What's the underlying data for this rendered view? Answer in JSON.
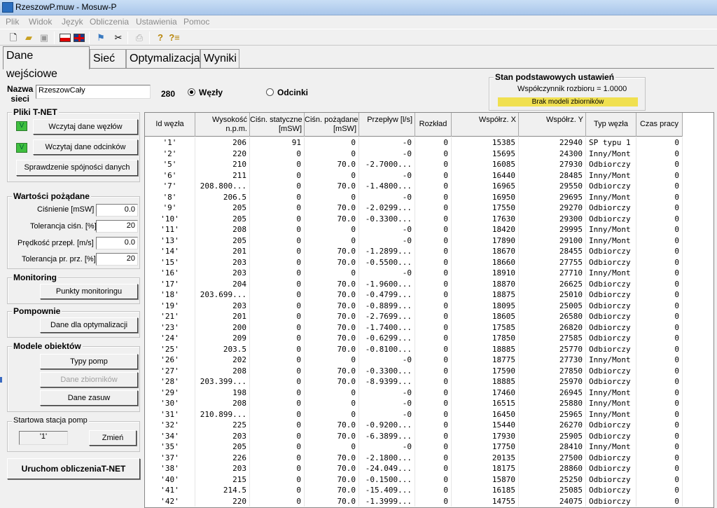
{
  "window": {
    "title": "RzeszowP.muw - Mosuw-P"
  },
  "menu": [
    "Plik",
    "Widok",
    "Język",
    "Obliczenia",
    "Ustawienia",
    "Pomoc"
  ],
  "toolbar": [
    "new-file-icon",
    "open-folder-icon",
    "save-icon",
    "polish-flag-icon",
    "uk-flag-icon",
    "hydrant-run-icon",
    "scissors-icon",
    "print-icon",
    "help-icon",
    "help-context-icon"
  ],
  "tabs": [
    "Dane wejściowe",
    "Sieć",
    "Optymalizacja",
    "Wyniki"
  ],
  "network": {
    "name_label": "Nazwa\nsieci",
    "name_value": "RzeszowCały",
    "count": "280",
    "opt_nodes": "Węzły",
    "opt_segments": "Odcinki"
  },
  "settings": {
    "title": "Stan podstawowych ustawień",
    "coef": "Współczynnik rozbioru = 1.0000",
    "tanks": "Brak modeli zbiorników"
  },
  "tnet": {
    "title": "Pliki T-NET",
    "v1": "V",
    "load_nodes": "Wczytaj dane węzłów",
    "v2": "V",
    "load_segments": "Wczytaj dane odcinków",
    "check": "Sprawdzenie spójności danych"
  },
  "desired": {
    "title": "Wartości pożądane",
    "pressure_label": "Ciśnienie [mSW]",
    "pressure": "0.0",
    "tol_p_label": "Tolerancja ciśn. [%]",
    "tol_p": "20",
    "velocity_label": "Prędkość przepł. [m/s]",
    "velocity": "0.0",
    "tol_v_label": "Tolerancja pr. prz. [%]",
    "tol_v": "20"
  },
  "monitoring": {
    "title": "Monitoring",
    "button": "Punkty monitoringu"
  },
  "pumping": {
    "title": "Pompownie",
    "button": "Dane dla optymalizacji"
  },
  "models": {
    "title": "Modele obiektów",
    "pumps": "Typy pomp",
    "tanks": "Dane zbiorników",
    "valves": "Dane zasuw"
  },
  "startpump": {
    "title": "Startowa stacja pomp",
    "value": "'1'",
    "change": "Zmień"
  },
  "run": "Uruchom obliczeniaT-NET",
  "table": {
    "headers": [
      "Id węzła",
      "Wysokość\nn.p.m.",
      "Ciśn. statyczne\n[mSW]",
      "Ciśn. pożądane\n[mSW]",
      "Przepływ [l/s]",
      "Rozkład",
      "Współrz. X",
      "Współrz. Y",
      "Typ węzła",
      "Czas pracy"
    ],
    "rows": [
      [
        "'1'",
        "206",
        "91",
        "0",
        "-0",
        "0",
        "15385",
        "22940",
        "SP typu 1",
        "0"
      ],
      [
        "'2'",
        "220",
        "0",
        "0",
        "-0",
        "0",
        "15695",
        "24300",
        "Inny/Mont",
        "0"
      ],
      [
        "'5'",
        "210",
        "0",
        "70.0",
        "-2.7000...",
        "0",
        "16085",
        "27930",
        "Odbiorczy",
        "0"
      ],
      [
        "'6'",
        "211",
        "0",
        "0",
        "-0",
        "0",
        "16440",
        "28485",
        "Inny/Mont",
        "0"
      ],
      [
        "'7'",
        "208.800...",
        "0",
        "70.0",
        "-1.4800...",
        "0",
        "16965",
        "29550",
        "Odbiorczy",
        "0"
      ],
      [
        "'8'",
        "206.5",
        "0",
        "0",
        "-0",
        "0",
        "16950",
        "29695",
        "Inny/Mont",
        "0"
      ],
      [
        "'9'",
        "205",
        "0",
        "70.0",
        "-2.0299...",
        "0",
        "17550",
        "29270",
        "Odbiorczy",
        "0"
      ],
      [
        "'10'",
        "205",
        "0",
        "70.0",
        "-0.3300...",
        "0",
        "17630",
        "29300",
        "Odbiorczy",
        "0"
      ],
      [
        "'11'",
        "208",
        "0",
        "0",
        "-0",
        "0",
        "18420",
        "29995",
        "Inny/Mont",
        "0"
      ],
      [
        "'13'",
        "205",
        "0",
        "0",
        "-0",
        "0",
        "17890",
        "29100",
        "Inny/Mont",
        "0"
      ],
      [
        "'14'",
        "201",
        "0",
        "70.0",
        "-1.2899...",
        "0",
        "18670",
        "28455",
        "Odbiorczy",
        "0"
      ],
      [
        "'15'",
        "203",
        "0",
        "70.0",
        "-0.5500...",
        "0",
        "18660",
        "27755",
        "Odbiorczy",
        "0"
      ],
      [
        "'16'",
        "203",
        "0",
        "0",
        "-0",
        "0",
        "18910",
        "27710",
        "Inny/Mont",
        "0"
      ],
      [
        "'17'",
        "204",
        "0",
        "70.0",
        "-1.9600...",
        "0",
        "18870",
        "26625",
        "Odbiorczy",
        "0"
      ],
      [
        "'18'",
        "203.699...",
        "0",
        "70.0",
        "-0.4799...",
        "0",
        "18875",
        "25010",
        "Odbiorczy",
        "0"
      ],
      [
        "'19'",
        "203",
        "0",
        "70.0",
        "-0.8899...",
        "0",
        "18095",
        "25005",
        "Odbiorczy",
        "0"
      ],
      [
        "'21'",
        "201",
        "0",
        "70.0",
        "-2.7699...",
        "0",
        "18605",
        "26580",
        "Odbiorczy",
        "0"
      ],
      [
        "'23'",
        "200",
        "0",
        "70.0",
        "-1.7400...",
        "0",
        "17585",
        "26820",
        "Odbiorczy",
        "0"
      ],
      [
        "'24'",
        "209",
        "0",
        "70.0",
        "-0.6299...",
        "0",
        "17850",
        "27585",
        "Odbiorczy",
        "0"
      ],
      [
        "'25'",
        "203.5",
        "0",
        "70.0",
        "-0.8100...",
        "0",
        "18885",
        "25770",
        "Odbiorczy",
        "0"
      ],
      [
        "'26'",
        "202",
        "0",
        "0",
        "-0",
        "0",
        "18775",
        "27730",
        "Inny/Mont",
        "0"
      ],
      [
        "'27'",
        "208",
        "0",
        "70.0",
        "-0.3300...",
        "0",
        "17590",
        "27850",
        "Odbiorczy",
        "0"
      ],
      [
        "'28'",
        "203.399...",
        "0",
        "70.0",
        "-8.9399...",
        "0",
        "18885",
        "25970",
        "Odbiorczy",
        "0"
      ],
      [
        "'29'",
        "198",
        "0",
        "0",
        "-0",
        "0",
        "17460",
        "26945",
        "Inny/Mont",
        "0"
      ],
      [
        "'30'",
        "208",
        "0",
        "0",
        "-0",
        "0",
        "16515",
        "25880",
        "Inny/Mont",
        "0"
      ],
      [
        "'31'",
        "210.899...",
        "0",
        "0",
        "-0",
        "0",
        "16450",
        "25965",
        "Inny/Mont",
        "0"
      ],
      [
        "'32'",
        "225",
        "0",
        "70.0",
        "-0.9200...",
        "0",
        "15440",
        "26270",
        "Odbiorczy",
        "0"
      ],
      [
        "'34'",
        "203",
        "0",
        "70.0",
        "-6.3899...",
        "0",
        "17930",
        "25905",
        "Odbiorczy",
        "0"
      ],
      [
        "'35'",
        "205",
        "0",
        "0",
        "-0",
        "0",
        "17750",
        "28410",
        "Inny/Mont",
        "0"
      ],
      [
        "'37'",
        "226",
        "0",
        "70.0",
        "-2.1800...",
        "0",
        "20135",
        "27500",
        "Odbiorczy",
        "0"
      ],
      [
        "'38'",
        "203",
        "0",
        "70.0",
        "-24.049...",
        "0",
        "18175",
        "28860",
        "Odbiorczy",
        "0"
      ],
      [
        "'40'",
        "215",
        "0",
        "70.0",
        "-0.1500...",
        "0",
        "15870",
        "25250",
        "Odbiorczy",
        "0"
      ],
      [
        "'41'",
        "214.5",
        "0",
        "70.0",
        "-15.409...",
        "0",
        "16185",
        "25085",
        "Odbiorczy",
        "0"
      ],
      [
        "'42'",
        "220",
        "0",
        "70.0",
        "-1.3999...",
        "0",
        "14755",
        "24075",
        "Odbiorczy",
        "0"
      ]
    ]
  }
}
